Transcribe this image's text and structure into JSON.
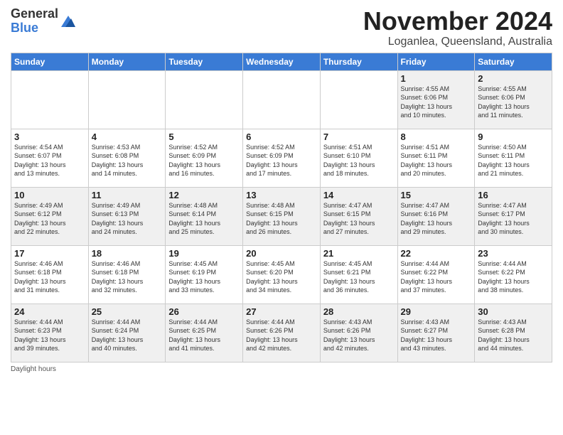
{
  "header": {
    "logo_line1": "General",
    "logo_line2": "Blue",
    "month_title": "November 2024",
    "location": "Loganlea, Queensland, Australia"
  },
  "days_of_week": [
    "Sunday",
    "Monday",
    "Tuesday",
    "Wednesday",
    "Thursday",
    "Friday",
    "Saturday"
  ],
  "weeks": [
    [
      {
        "day": "",
        "info": ""
      },
      {
        "day": "",
        "info": ""
      },
      {
        "day": "",
        "info": ""
      },
      {
        "day": "",
        "info": ""
      },
      {
        "day": "",
        "info": ""
      },
      {
        "day": "1",
        "info": "Sunrise: 4:55 AM\nSunset: 6:06 PM\nDaylight: 13 hours\nand 10 minutes."
      },
      {
        "day": "2",
        "info": "Sunrise: 4:55 AM\nSunset: 6:06 PM\nDaylight: 13 hours\nand 11 minutes."
      }
    ],
    [
      {
        "day": "3",
        "info": "Sunrise: 4:54 AM\nSunset: 6:07 PM\nDaylight: 13 hours\nand 13 minutes."
      },
      {
        "day": "4",
        "info": "Sunrise: 4:53 AM\nSunset: 6:08 PM\nDaylight: 13 hours\nand 14 minutes."
      },
      {
        "day": "5",
        "info": "Sunrise: 4:52 AM\nSunset: 6:09 PM\nDaylight: 13 hours\nand 16 minutes."
      },
      {
        "day": "6",
        "info": "Sunrise: 4:52 AM\nSunset: 6:09 PM\nDaylight: 13 hours\nand 17 minutes."
      },
      {
        "day": "7",
        "info": "Sunrise: 4:51 AM\nSunset: 6:10 PM\nDaylight: 13 hours\nand 18 minutes."
      },
      {
        "day": "8",
        "info": "Sunrise: 4:51 AM\nSunset: 6:11 PM\nDaylight: 13 hours\nand 20 minutes."
      },
      {
        "day": "9",
        "info": "Sunrise: 4:50 AM\nSunset: 6:11 PM\nDaylight: 13 hours\nand 21 minutes."
      }
    ],
    [
      {
        "day": "10",
        "info": "Sunrise: 4:49 AM\nSunset: 6:12 PM\nDaylight: 13 hours\nand 22 minutes."
      },
      {
        "day": "11",
        "info": "Sunrise: 4:49 AM\nSunset: 6:13 PM\nDaylight: 13 hours\nand 24 minutes."
      },
      {
        "day": "12",
        "info": "Sunrise: 4:48 AM\nSunset: 6:14 PM\nDaylight: 13 hours\nand 25 minutes."
      },
      {
        "day": "13",
        "info": "Sunrise: 4:48 AM\nSunset: 6:15 PM\nDaylight: 13 hours\nand 26 minutes."
      },
      {
        "day": "14",
        "info": "Sunrise: 4:47 AM\nSunset: 6:15 PM\nDaylight: 13 hours\nand 27 minutes."
      },
      {
        "day": "15",
        "info": "Sunrise: 4:47 AM\nSunset: 6:16 PM\nDaylight: 13 hours\nand 29 minutes."
      },
      {
        "day": "16",
        "info": "Sunrise: 4:47 AM\nSunset: 6:17 PM\nDaylight: 13 hours\nand 30 minutes."
      }
    ],
    [
      {
        "day": "17",
        "info": "Sunrise: 4:46 AM\nSunset: 6:18 PM\nDaylight: 13 hours\nand 31 minutes."
      },
      {
        "day": "18",
        "info": "Sunrise: 4:46 AM\nSunset: 6:18 PM\nDaylight: 13 hours\nand 32 minutes."
      },
      {
        "day": "19",
        "info": "Sunrise: 4:45 AM\nSunset: 6:19 PM\nDaylight: 13 hours\nand 33 minutes."
      },
      {
        "day": "20",
        "info": "Sunrise: 4:45 AM\nSunset: 6:20 PM\nDaylight: 13 hours\nand 34 minutes."
      },
      {
        "day": "21",
        "info": "Sunrise: 4:45 AM\nSunset: 6:21 PM\nDaylight: 13 hours\nand 36 minutes."
      },
      {
        "day": "22",
        "info": "Sunrise: 4:44 AM\nSunset: 6:22 PM\nDaylight: 13 hours\nand 37 minutes."
      },
      {
        "day": "23",
        "info": "Sunrise: 4:44 AM\nSunset: 6:22 PM\nDaylight: 13 hours\nand 38 minutes."
      }
    ],
    [
      {
        "day": "24",
        "info": "Sunrise: 4:44 AM\nSunset: 6:23 PM\nDaylight: 13 hours\nand 39 minutes."
      },
      {
        "day": "25",
        "info": "Sunrise: 4:44 AM\nSunset: 6:24 PM\nDaylight: 13 hours\nand 40 minutes."
      },
      {
        "day": "26",
        "info": "Sunrise: 4:44 AM\nSunset: 6:25 PM\nDaylight: 13 hours\nand 41 minutes."
      },
      {
        "day": "27",
        "info": "Sunrise: 4:44 AM\nSunset: 6:26 PM\nDaylight: 13 hours\nand 42 minutes."
      },
      {
        "day": "28",
        "info": "Sunrise: 4:43 AM\nSunset: 6:26 PM\nDaylight: 13 hours\nand 42 minutes."
      },
      {
        "day": "29",
        "info": "Sunrise: 4:43 AM\nSunset: 6:27 PM\nDaylight: 13 hours\nand 43 minutes."
      },
      {
        "day": "30",
        "info": "Sunrise: 4:43 AM\nSunset: 6:28 PM\nDaylight: 13 hours\nand 44 minutes."
      }
    ]
  ],
  "footer": {
    "daylight_label": "Daylight hours"
  }
}
